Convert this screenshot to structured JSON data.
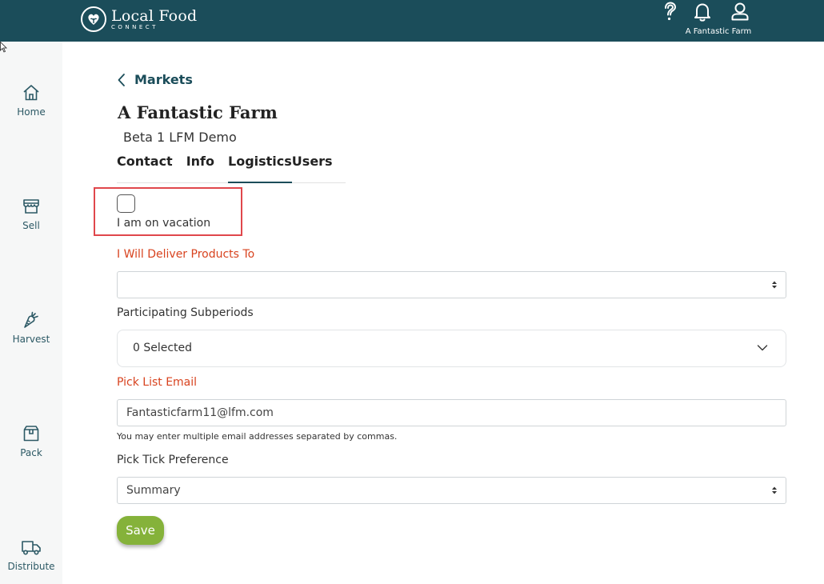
{
  "header": {
    "brand_title": "Local Food",
    "brand_sub": "CONNECT",
    "user_label": "A Fantastic Farm",
    "icons": [
      "help-icon",
      "bell-icon",
      "user-icon"
    ]
  },
  "sidebar": {
    "items": [
      {
        "label": "Home",
        "icon": "home-icon"
      },
      {
        "label": "Sell",
        "icon": "store-icon"
      },
      {
        "label": "Harvest",
        "icon": "carrot-icon"
      },
      {
        "label": "Pack",
        "icon": "box-icon"
      },
      {
        "label": "Distribute",
        "icon": "truck-icon"
      }
    ]
  },
  "main": {
    "back_label": "Markets",
    "farm_title": "A Fantastic Farm",
    "farm_sub": "Beta 1 LFM Demo",
    "tabs": [
      {
        "label": "Contact",
        "active": false
      },
      {
        "label": "Info",
        "active": false
      },
      {
        "label": "Logistics",
        "active": true
      },
      {
        "label": "Users",
        "active": false
      }
    ],
    "vacation": {
      "label": "I am on vacation",
      "checked": false
    },
    "deliver": {
      "label": "I Will Deliver Products To",
      "value": ""
    },
    "subperiods": {
      "label": "Participating Subperiods",
      "value": "0 Selected"
    },
    "pick_email": {
      "label": "Pick List Email",
      "value": "Fantasticfarm11@lfm.com",
      "help": "You may enter multiple email addresses separated by commas."
    },
    "pick_tick": {
      "label": "Pick Tick Preference",
      "value": "Summary"
    },
    "save_label": "Save"
  },
  "colors": {
    "brand": "#1b4d5a",
    "required": "#d8431f",
    "save": "#85b23a",
    "highlight": "#e0474c"
  }
}
